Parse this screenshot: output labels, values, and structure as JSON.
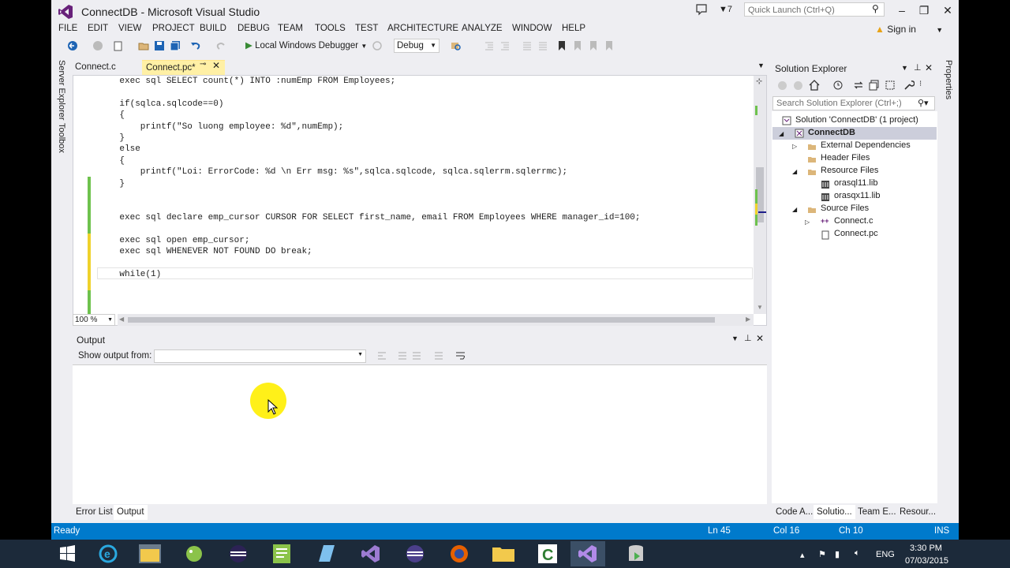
{
  "window": {
    "title": "ConnectDB - Microsoft Visual Studio",
    "notification_count": "7",
    "quick_launch_placeholder": "Quick Launch (Ctrl+Q)",
    "sign_in": "Sign in"
  },
  "menu": [
    "FILE",
    "EDIT",
    "VIEW",
    "PROJECT",
    "BUILD",
    "DEBUG",
    "TEAM",
    "TOOLS",
    "TEST",
    "ARCHITECTURE",
    "ANALYZE",
    "WINDOW",
    "HELP"
  ],
  "toolbar": {
    "debugger_label": "Local Windows Debugger",
    "configuration": "Debug"
  },
  "left_tabs": [
    "Server Explorer",
    "Toolbox"
  ],
  "right_tabs": [
    "Properties"
  ],
  "document_tabs": [
    {
      "label": "Connect.c",
      "active": false
    },
    {
      "label": "Connect.pc*",
      "active": true
    }
  ],
  "editor": {
    "zoom": "100 %",
    "lines": [
      "    exec sql SELECT count(*) INTO :numEmp FROM Employees;",
      "",
      "    if(sqlca.sqlcode==0)",
      "    {",
      "        printf(\"So luong employee: %d\",numEmp);",
      "    }",
      "    else",
      "    {",
      "        printf(\"Loi: ErrorCode: %d \\n Err msg: %s\",sqlca.sqlcode, sqlca.sqlerrm.sqlerrmc);",
      "    }",
      "",
      "",
      "    exec sql declare emp_cursor CURSOR FOR SELECT first_name, email FROM Employees WHERE manager_id=100;",
      "",
      "    exec sql open emp_cursor;",
      "    exec sql WHENEVER NOT FOUND DO break;",
      "",
      "    while(1)"
    ]
  },
  "output": {
    "title": "Output",
    "show_output_from": "Show output from:",
    "source": ""
  },
  "bottom_tabs": [
    "Error List",
    "Output"
  ],
  "solution_explorer": {
    "title": "Solution Explorer",
    "search_placeholder": "Search Solution Explorer (Ctrl+;)",
    "items": [
      {
        "label": "Solution 'ConnectDB' (1 project)",
        "icon": "solution-icon"
      },
      {
        "label": "ConnectDB",
        "icon": "project-icon",
        "selected": true
      },
      {
        "label": "External Dependencies",
        "icon": "folder-icon"
      },
      {
        "label": "Header Files",
        "icon": "folder-icon"
      },
      {
        "label": "Resource Files",
        "icon": "folder-icon"
      },
      {
        "label": "orasql11.lib",
        "icon": "lib-file-icon"
      },
      {
        "label": "orasqx11.lib",
        "icon": "lib-file-icon"
      },
      {
        "label": "Source Files",
        "icon": "folder-icon"
      },
      {
        "label": "Connect.c",
        "icon": "cpp-file-icon"
      },
      {
        "label": "Connect.pc",
        "icon": "file-icon"
      }
    ],
    "bottom_tabs": [
      "Code A...",
      "Solutio...",
      "Team E...",
      "Resour..."
    ]
  },
  "status": {
    "state": "Ready",
    "line": "Ln 45",
    "col": "Col 16",
    "ch": "Ch 10",
    "mode": "INS"
  },
  "taskbar": {
    "apps": [
      "start-icon",
      "internet-explorer-icon",
      "file-explorer-icon",
      "pidgin-icon",
      "eclipse-icon",
      "notepad-icon",
      "document-icon",
      "visual-studio-old-icon",
      "eclipse-dark-icon",
      "firefox-icon",
      "folder-app-icon",
      "camtasia-icon",
      "visual-studio-icon",
      "database-icon"
    ],
    "language": "ENG",
    "time": "3:30 PM",
    "date": "07/03/2015"
  },
  "colors": {
    "accent": "#007acc",
    "active_tab": "#fff0a5",
    "selection": "#cccedb",
    "change_saved": "#6ec24d",
    "change_unsaved": "#efd22c"
  }
}
